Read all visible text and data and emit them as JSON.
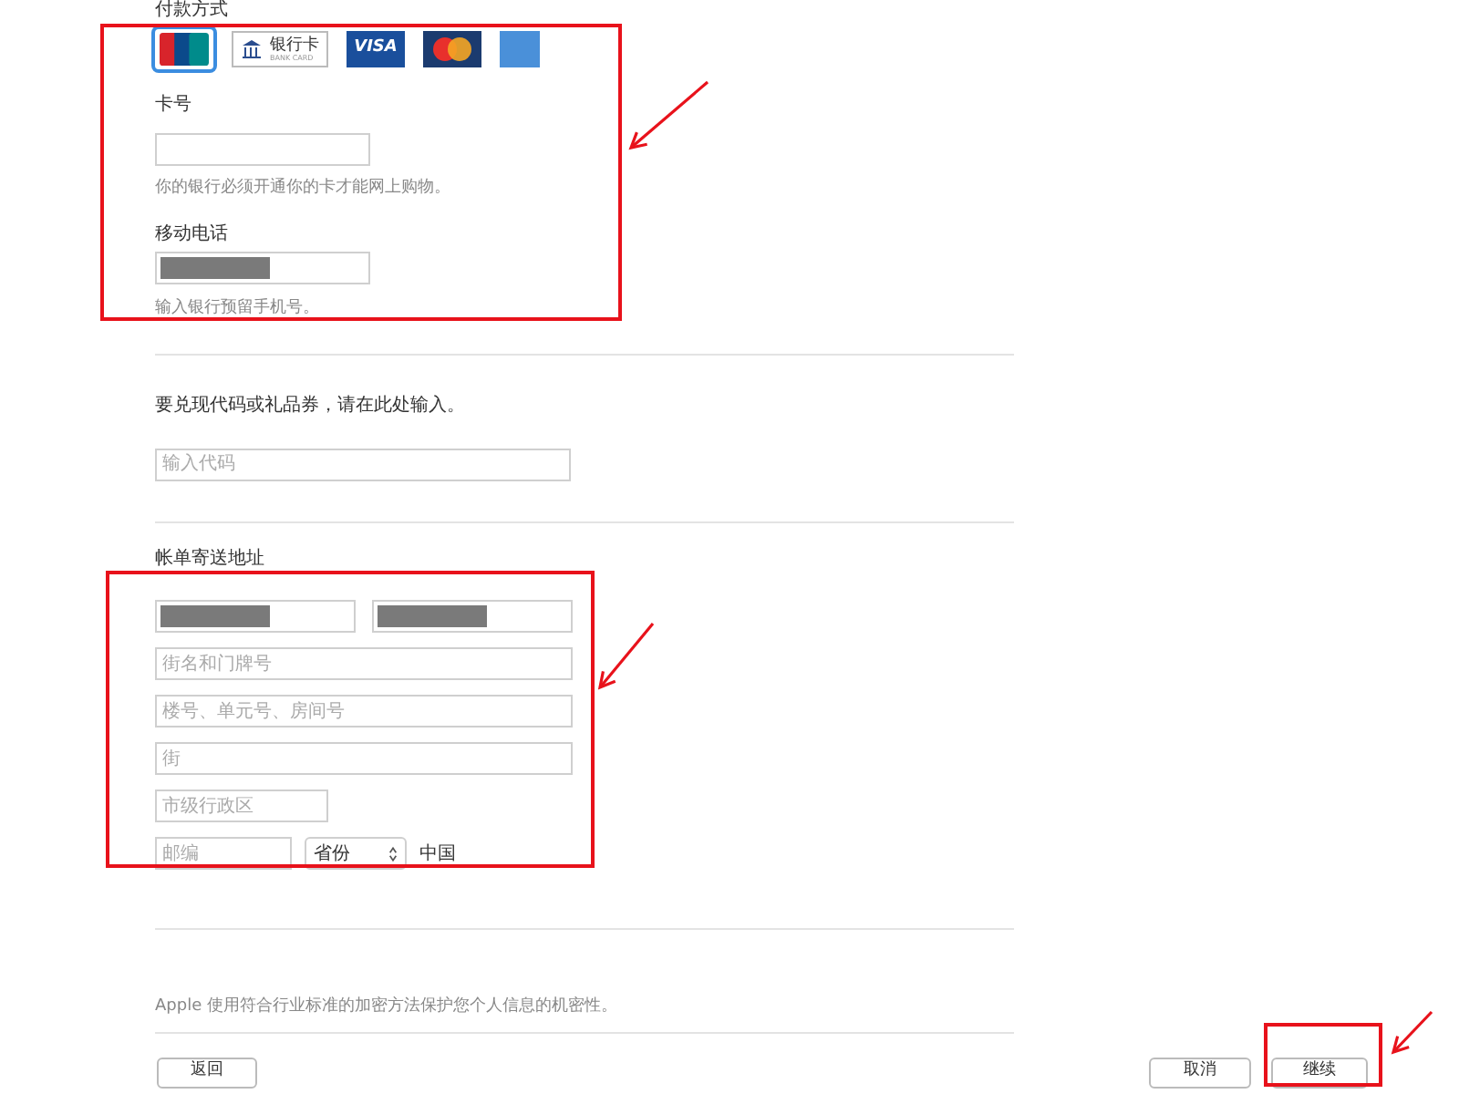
{
  "payment": {
    "title": "付款方式",
    "methods": [
      {
        "kind": "unionpay",
        "selected": true
      },
      {
        "kind": "bankcard",
        "label": "银行卡",
        "sublabel": "BANK CARD",
        "selected": false
      },
      {
        "kind": "visa",
        "label": "VISA",
        "selected": false
      },
      {
        "kind": "mastercard",
        "selected": false
      },
      {
        "kind": "amex",
        "selected": false
      }
    ],
    "card_number": {
      "label": "卡号",
      "hint": "你的银行必须开通你的卡才能网上购物。"
    },
    "mobile": {
      "label": "移动电话",
      "redacted": true,
      "hint": "输入银行预留手机号。"
    }
  },
  "redeem": {
    "label": "要兑现代码或礼品券，请在此处输入。",
    "placeholder": "输入代码"
  },
  "billing": {
    "title": "帐单寄送地址",
    "last_name": {
      "redacted": true
    },
    "first_name": {
      "redacted": true
    },
    "street": {
      "placeholder": "街名和门牌号"
    },
    "building": {
      "placeholder": "楼号、单元号、房间号"
    },
    "district": {
      "placeholder": "街"
    },
    "city": {
      "placeholder": "市级行政区"
    },
    "postcode": {
      "placeholder": "邮编"
    },
    "province": {
      "value": "省份"
    },
    "country": "中国"
  },
  "notice": "Apple 使用符合行业标准的加密方法保护您个人信息的机密性。",
  "buttons": {
    "back": "返回",
    "cancel": "取消",
    "continue": "继续"
  }
}
